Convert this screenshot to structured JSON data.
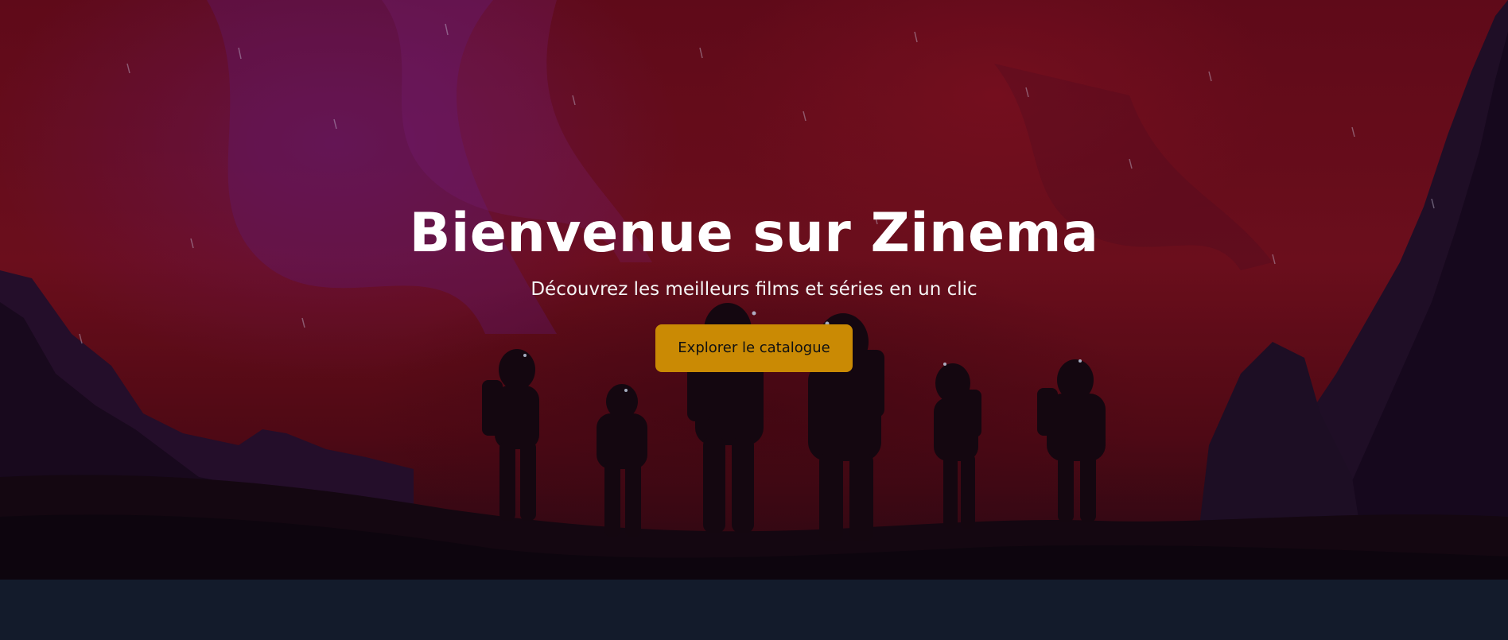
{
  "hero": {
    "title": "Bienvenue sur Zinema",
    "subtitle": "Découvrez les meilleurs films et séries en un clic",
    "cta_label": "Explorer le catalogue",
    "background_art": "astronauts-silhouettes-alien-landscape"
  },
  "colors": {
    "accent": "#ca8a04",
    "hero_red": "#7a1020",
    "bottom_band": "#131b2b",
    "text": "#ffffff"
  }
}
